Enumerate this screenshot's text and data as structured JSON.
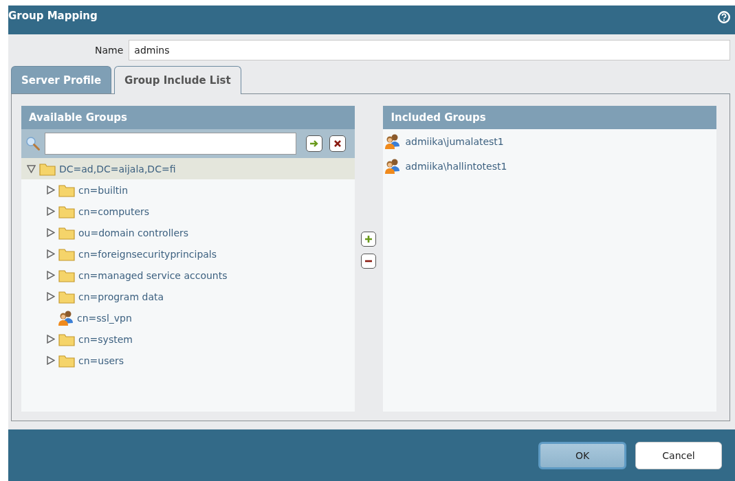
{
  "window": {
    "title": "Group Mapping"
  },
  "name_field": {
    "label": "Name",
    "value": "admins"
  },
  "tabs": [
    {
      "label": "Server Profile",
      "selected": false
    },
    {
      "label": "Group Include List",
      "selected": true
    }
  ],
  "available_groups": {
    "title": "Available Groups",
    "tree": [
      {
        "label": "DC=ad,DC=aijala,DC=fi",
        "kind": "folder",
        "expanded": true,
        "selected": true,
        "children": [
          {
            "label": "cn=builtin",
            "kind": "folder",
            "expanded": false,
            "selected": false
          },
          {
            "label": "cn=computers",
            "kind": "folder",
            "expanded": false,
            "selected": false
          },
          {
            "label": "ou=domain controllers",
            "kind": "folder",
            "expanded": false,
            "selected": false
          },
          {
            "label": "cn=foreignsecurityprincipals",
            "kind": "folder",
            "expanded": false,
            "selected": false
          },
          {
            "label": "cn=managed service accounts",
            "kind": "folder",
            "expanded": false,
            "selected": false
          },
          {
            "label": "cn=program data",
            "kind": "folder",
            "expanded": false,
            "selected": false
          },
          {
            "label": "cn=ssl_vpn",
            "kind": "group",
            "selected": false
          },
          {
            "label": "cn=system",
            "kind": "folder",
            "expanded": false,
            "selected": false
          },
          {
            "label": "cn=users",
            "kind": "folder",
            "expanded": false,
            "selected": false
          }
        ]
      }
    ]
  },
  "included_groups": {
    "title": "Included Groups",
    "items": [
      "admiika\\jumalatest1",
      "admiika\\hallintotest1"
    ]
  },
  "buttons": [
    {
      "label": "OK",
      "kind": "primary"
    },
    {
      "label": "Cancel",
      "kind": "secondary"
    }
  ]
}
